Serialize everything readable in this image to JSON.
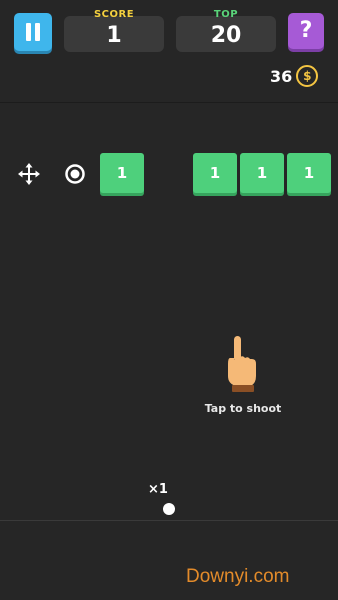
{
  "header": {
    "score_label": "SCORE",
    "score_value": "1",
    "top_label": "TOP",
    "top_value": "20",
    "help_label": "?"
  },
  "coins": {
    "count": "36",
    "symbol": "$"
  },
  "bricks": [
    {
      "value": "1"
    },
    {
      "value": "1"
    },
    {
      "value": "1"
    },
    {
      "value": "1"
    }
  ],
  "hint": {
    "text": "Tap to shoot"
  },
  "balls": {
    "multiplier": "×1"
  },
  "watermark": "Downyi.com",
  "colors": {
    "background": "#262626",
    "pause_button": "#3fb6ec",
    "help_button": "#a65ad6",
    "brick": "#4ed07c",
    "score_label": "#f4d03f",
    "top_label": "#5ad47a",
    "coin": "#f4c542",
    "watermark": "#e38b2a"
  },
  "icons": [
    "pause-icon",
    "question-icon",
    "coin-icon",
    "move-icon",
    "target-icon",
    "pointing-hand-icon"
  ]
}
